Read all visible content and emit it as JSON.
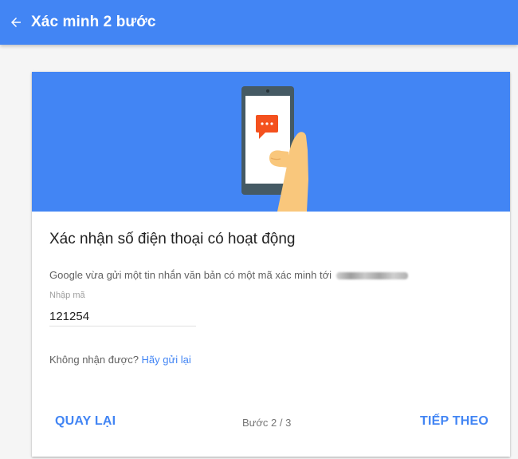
{
  "header": {
    "title": "Xác minh 2 bước",
    "back_icon": "arrow-back-icon"
  },
  "hero": {
    "illustration": "phone-with-message-in-hand",
    "icon": "chat-bubble-icon",
    "colors": {
      "background": "#4285f4",
      "bubble": "#f4511e",
      "hand": "#f9c77c"
    }
  },
  "card": {
    "title": "Xác nhận số điện thoại có hoạt động",
    "description": "Google vừa gửi một tin nhắn văn bản có một mã xác minh tới",
    "code_field": {
      "label": "Nhập mã",
      "value": "121254"
    },
    "resend": {
      "prompt": "Không nhận được?",
      "link": "Hãy gửi lại"
    }
  },
  "footer": {
    "back_label": "QUAY LẠI",
    "step": "Bước 2 / 3",
    "next_label": "TIẾP THEO"
  },
  "colors": {
    "accent": "#4285f4",
    "page_background": "#f5f5f5"
  }
}
